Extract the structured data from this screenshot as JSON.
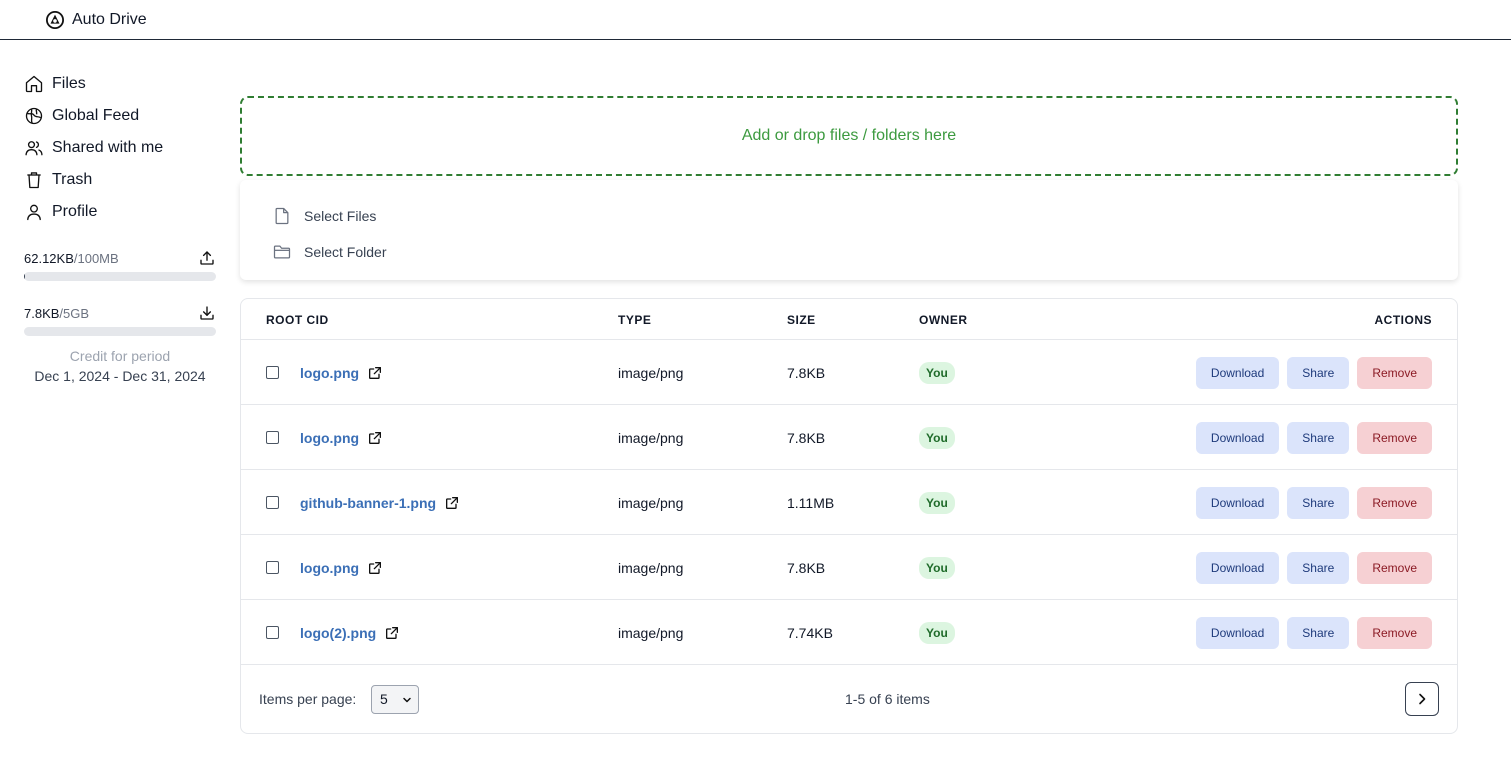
{
  "app": {
    "name": "Auto Drive"
  },
  "sidebar": {
    "items": [
      {
        "label": "Files",
        "icon": "home-icon"
      },
      {
        "label": "Global Feed",
        "icon": "globe-icon"
      },
      {
        "label": "Shared with me",
        "icon": "users-icon"
      },
      {
        "label": "Trash",
        "icon": "trash-icon"
      },
      {
        "label": "Profile",
        "icon": "user-icon"
      }
    ],
    "upload_usage": {
      "used": "62.12KB",
      "limit": "/100MB",
      "fraction": 0.0006
    },
    "download_usage": {
      "used": "7.8KB",
      "limit": "/5GB",
      "fraction": 0.0
    },
    "credit": {
      "label": "Credit for period",
      "dates": "Dec 1, 2024 - Dec 31, 2024"
    }
  },
  "dropzone": {
    "text": "Add or drop files / folders here"
  },
  "select_menu": {
    "files": "Select Files",
    "folder": "Select Folder"
  },
  "table": {
    "headers": {
      "cid": "ROOT CID",
      "type": "TYPE",
      "size": "SIZE",
      "owner": "OWNER",
      "actions": "ACTIONS"
    },
    "rows": [
      {
        "name": "logo.png",
        "type": "image/png",
        "size": "7.8KB",
        "owner": "You"
      },
      {
        "name": "logo.png",
        "type": "image/png",
        "size": "7.8KB",
        "owner": "You"
      },
      {
        "name": "github-banner-1.png",
        "type": "image/png",
        "size": "1.11MB",
        "owner": "You"
      },
      {
        "name": "logo.png",
        "type": "image/png",
        "size": "7.8KB",
        "owner": "You"
      },
      {
        "name": "logo(2).png",
        "type": "image/png",
        "size": "7.74KB",
        "owner": "You"
      }
    ],
    "buttons": {
      "download": "Download",
      "share": "Share",
      "remove": "Remove"
    }
  },
  "pagination": {
    "per_page_label": "Items per page:",
    "per_page_value": "5",
    "range": "1-5 of 6 items"
  },
  "colors": {
    "accent_green": "#2f7d32",
    "link_blue": "#3b6fb6",
    "badge_green": "#dcf5e0",
    "remove_red": "#f6d0d3",
    "button_blue": "#dbe4fb"
  }
}
